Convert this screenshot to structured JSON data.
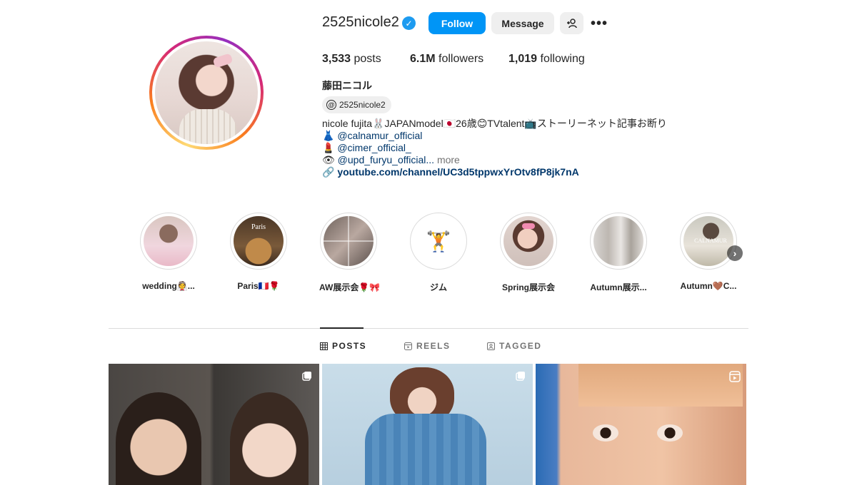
{
  "profile": {
    "username": "2525nicole2",
    "verified_icon": "verified-badge-icon",
    "follow_label": "Follow",
    "message_label": "Message",
    "add_user_icon": "add-user-icon",
    "more_label": "•••",
    "posts_count": "3,533",
    "posts_label": "posts",
    "followers_count": "6.1M",
    "followers_label": "followers",
    "following_count": "1,019",
    "following_label": "following",
    "full_name": "藤田ニコル",
    "threads_handle": "2525nicole2",
    "bio": {
      "line1": "nicole fujita🐰JAPANmodel🇯🇵26歳😊TVtalent📺ストーリーネット記事お断り",
      "line2_emoji": "👗",
      "line2_link": "@calnamur_official",
      "line3_emoji": "💄",
      "line3_link": "@cimer_official_",
      "line4_emoji": "👁",
      "line4_link": "@upd_furyu_official...",
      "line4_more": "more",
      "external_link": "youtube.com/channel/UC3d5tppwxYrOtv8fP8jk7nA"
    }
  },
  "highlights": [
    {
      "label": "wedding👰..."
    },
    {
      "label": "Paris🇫🇷🌹"
    },
    {
      "label": "AW展示会🌹🎀"
    },
    {
      "label": "ジム"
    },
    {
      "label": "Spring展示会"
    },
    {
      "label": "Autumn展示..."
    },
    {
      "label": "Autumn🤎C..."
    }
  ],
  "tabs": [
    {
      "label": "POSTS",
      "icon": "grid-icon",
      "active": true
    },
    {
      "label": "REELS",
      "icon": "reels-icon",
      "active": false
    },
    {
      "label": "TAGGED",
      "icon": "tagged-icon",
      "active": false
    }
  ],
  "colors": {
    "follow_button": "#0095f6",
    "link": "#00376b",
    "verified": "#1d9bf0"
  }
}
